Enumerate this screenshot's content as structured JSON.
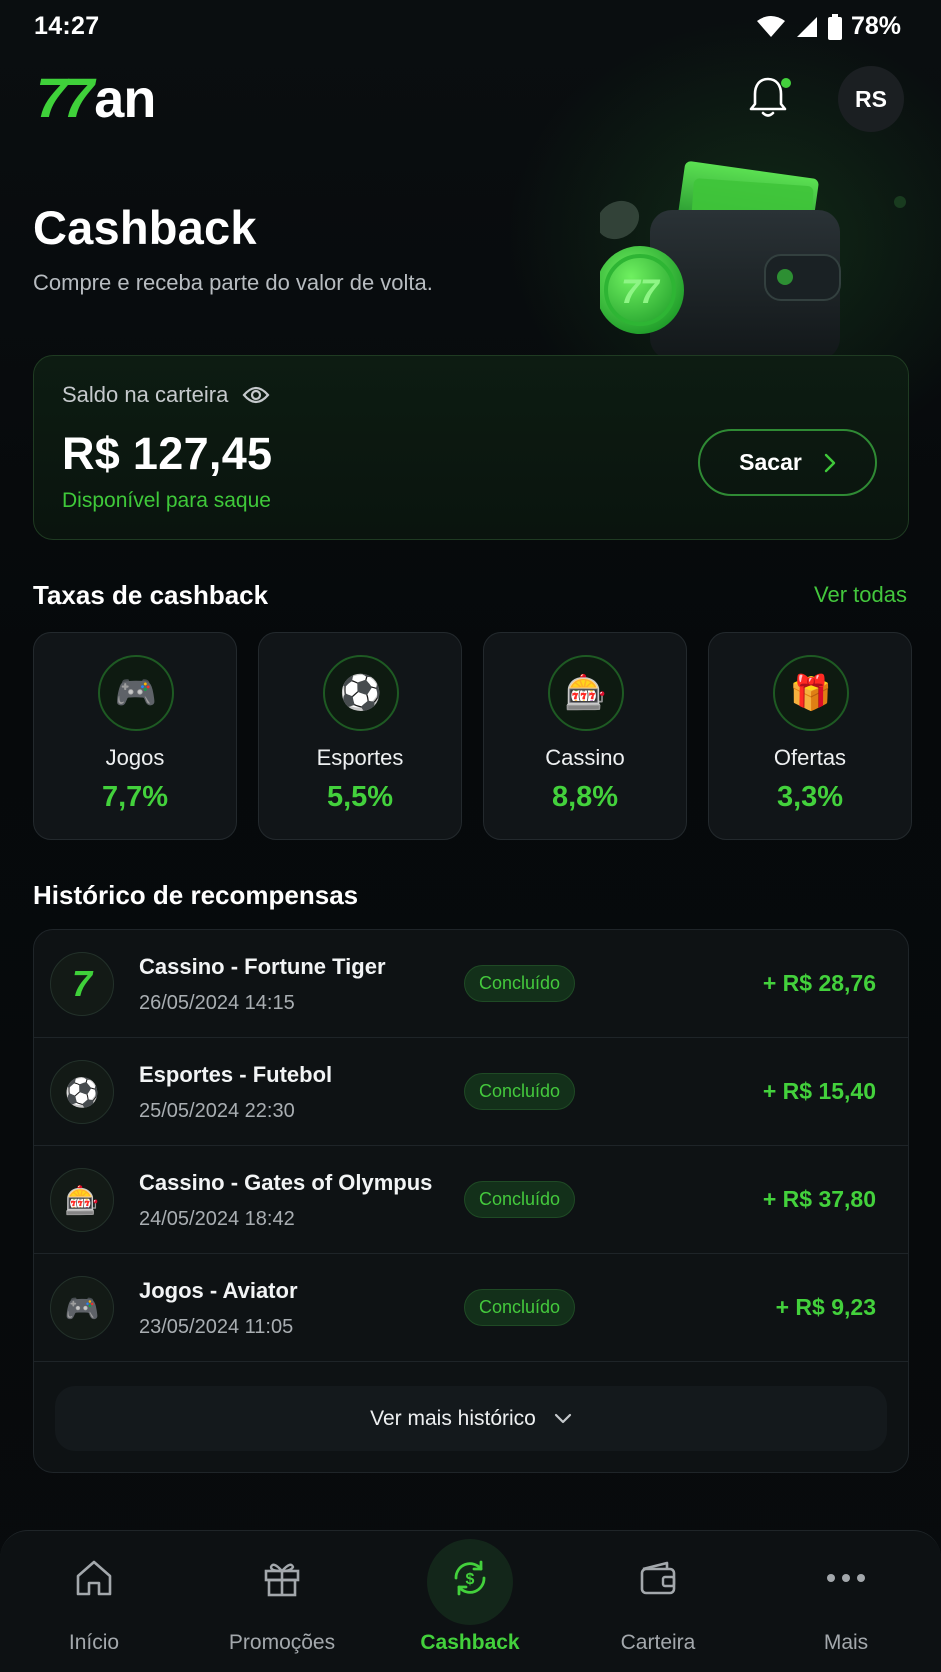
{
  "status_bar": {
    "time": "14:27",
    "battery": "78%"
  },
  "header": {
    "logo_number": "77",
    "logo_text": "an",
    "avatar_initials": "RS"
  },
  "hero": {
    "title": "Cashback",
    "subtitle": "Compre e receba parte do valor de volta."
  },
  "balance": {
    "label": "Saldo na carteira",
    "amount": "R$ 127,45",
    "available": "Disponível para saque",
    "button_label": "Sacar"
  },
  "rates": {
    "title": "Taxas de cashback",
    "see_all": "Ver todas",
    "items": [
      {
        "label": "Jogos",
        "value": "7,7%",
        "icon": "🎮"
      },
      {
        "label": "Esportes",
        "value": "5,5%",
        "icon": "⚽"
      },
      {
        "label": "Cassino",
        "value": "8,8%",
        "icon": "🎰"
      },
      {
        "label": "Ofertas",
        "value": "3,3%",
        "icon": "🎁"
      }
    ]
  },
  "history": {
    "title": "Histórico de recompensas",
    "rows": [
      {
        "title": "Cassino - Fortune Tiger",
        "date": "26/05/2024 14:15",
        "status": "Concluído",
        "amount": "+ R$ 28,76",
        "icon": "7"
      },
      {
        "title": "Esportes - Futebol",
        "date": "25/05/2024 22:30",
        "status": "Concluído",
        "amount": "+ R$ 15,40",
        "icon": "⚽"
      },
      {
        "title": "Cassino - Gates of Olympus",
        "date": "24/05/2024 18:42",
        "status": "Concluído",
        "amount": "+ R$ 37,80",
        "icon": "🎰"
      },
      {
        "title": "Jogos - Aviator",
        "date": "23/05/2024 11:05",
        "status": "Concluído",
        "amount": "+ R$ 9,23",
        "icon": "🎮"
      }
    ],
    "more_label": "Ver mais histórico"
  },
  "nav": {
    "items": [
      {
        "label": "Início",
        "icon": "home-icon"
      },
      {
        "label": "Promoções",
        "icon": "gift-icon"
      },
      {
        "label": "Cashback",
        "icon": "cashback-icon",
        "active": true
      },
      {
        "label": "Carteira",
        "icon": "wallet-icon"
      },
      {
        "label": "Mais",
        "icon": "more-icon"
      }
    ]
  },
  "colors": {
    "accent": "#43d13c",
    "background": "#06090b",
    "card": "#111518"
  }
}
